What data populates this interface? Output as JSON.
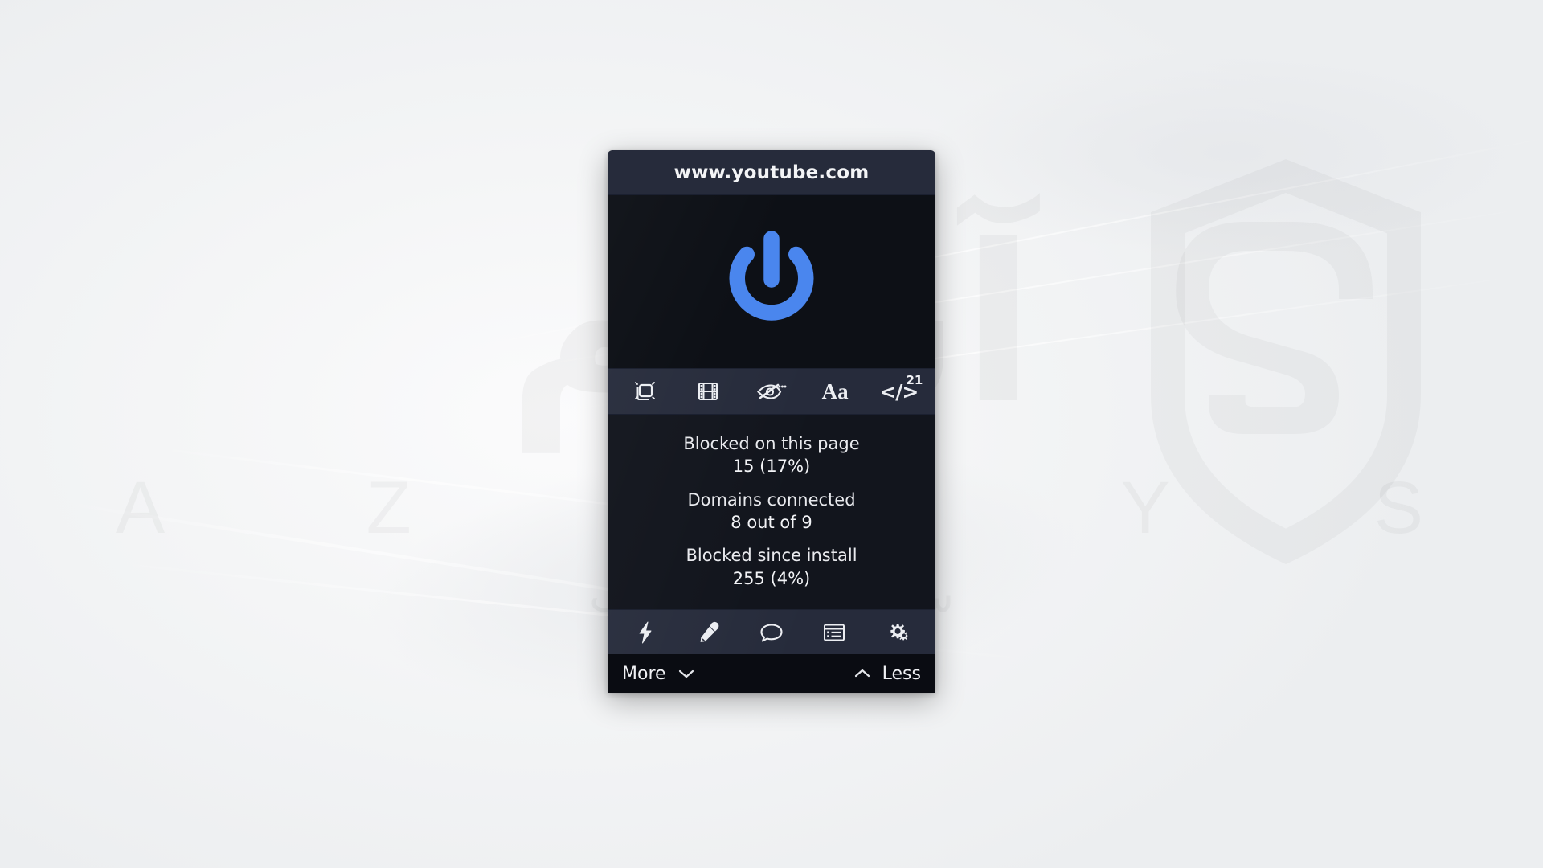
{
  "background": {
    "watermark": {
      "arabic_title": "آسام",
      "latin_title": "A Z A R Y S",
      "subtitle": "سرعت میزبانی وب",
      "logo_icon": "shield-s-logo-icon"
    },
    "base_color": "#f2f3f5"
  },
  "panel": {
    "name": "ublock-origin-popup",
    "hostname": "www.youtube.com",
    "accent_color": "#4a86ee",
    "header_bg": "#262b3b",
    "body_bg": "#12151d",
    "power": {
      "icon": "power-icon",
      "state": "enabled",
      "color": "#4a86ee"
    },
    "top_tools": [
      {
        "icon": "popup-blocker-icon",
        "label": "Block popups",
        "badge": ""
      },
      {
        "icon": "film-strip-icon",
        "label": "Block media elements",
        "badge": ""
      },
      {
        "icon": "eye-slash-dots-icon",
        "label": "Cosmetic filtering",
        "badge": ""
      },
      {
        "icon": "font-aa-icon",
        "label": "Remote fonts",
        "badge": ""
      },
      {
        "icon": "code-brackets-icon",
        "label": "JavaScript",
        "badge": "21"
      }
    ],
    "stats": [
      {
        "label": "Blocked on this page",
        "value": "15 (17%)"
      },
      {
        "label": "Domains connected",
        "value": "8 out of 9"
      },
      {
        "label": "Blocked since install",
        "value": "255 (4%)"
      }
    ],
    "bottom_tools": [
      {
        "icon": "lightning-bolt-icon",
        "label": "Disable/enable"
      },
      {
        "icon": "eyedropper-icon",
        "label": "Element picker"
      },
      {
        "icon": "speech-bubble-icon",
        "label": "Report broken page"
      },
      {
        "icon": "list-panel-icon",
        "label": "Open the logger"
      },
      {
        "icon": "gears-icon",
        "label": "Dashboard settings"
      }
    ],
    "expand_bar": {
      "more_label": "More",
      "more_icon": "chevron-down-icon",
      "less_label": "Less",
      "less_icon": "chevron-up-icon"
    }
  }
}
